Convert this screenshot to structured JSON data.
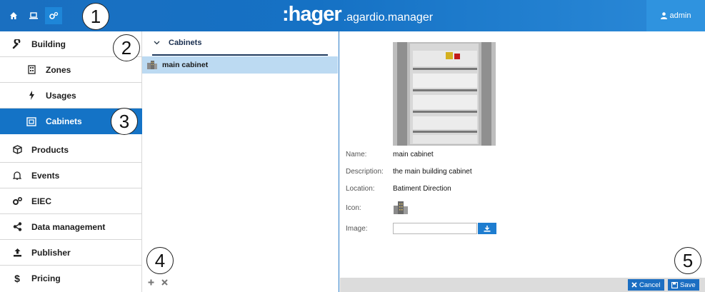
{
  "app": {
    "brand": ":hager",
    "product": ".agardio.manager",
    "user": "admin"
  },
  "callouts": [
    "1",
    "2",
    "3",
    "4",
    "5"
  ],
  "topnav": {
    "icons": [
      "home-icon",
      "laptop-icon",
      "gears-icon"
    ],
    "active": "gears-icon"
  },
  "sidebar": {
    "items": [
      {
        "label": "Building",
        "icon": "wrench-icon"
      },
      {
        "label": "Zones",
        "icon": "building-icon"
      },
      {
        "label": "Usages",
        "icon": "bolt-icon"
      },
      {
        "label": "Cabinets",
        "icon": "cabinet-icon"
      },
      {
        "label": "Products",
        "icon": "cube-icon"
      },
      {
        "label": "Events",
        "icon": "bell-icon"
      },
      {
        "label": "EIEC",
        "icon": "gears-icon"
      },
      {
        "label": "Data management",
        "icon": "share-icon"
      },
      {
        "label": "Publisher",
        "icon": "upload-icon"
      },
      {
        "label": "Pricing",
        "icon": "dollar-icon"
      }
    ],
    "active": "Cabinets"
  },
  "list": {
    "header": "Cabinets",
    "rows": [
      {
        "label": "main cabinet"
      }
    ]
  },
  "detail": {
    "name_label": "Name:",
    "name_value": "main cabinet",
    "description_label": "Description:",
    "description_value": "the main building cabinet",
    "location_label": "Location:",
    "location_value": "Batiment Direction",
    "icon_label": "Icon:",
    "image_label": "Image:",
    "image_value": ""
  },
  "footer": {
    "cancel": "Cancel",
    "save": "Save"
  },
  "colors": {
    "accent": "#1473c6",
    "selected_row": "#bcdaf2"
  }
}
